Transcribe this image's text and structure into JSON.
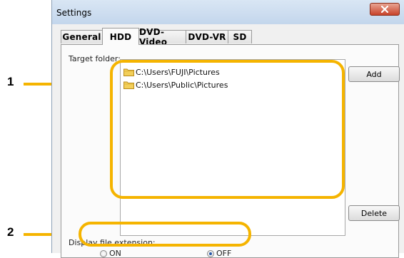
{
  "window": {
    "title": "Settings",
    "close_icon": "close-icon"
  },
  "tabs": [
    {
      "label": "General",
      "active": false
    },
    {
      "label": "HDD",
      "active": true
    },
    {
      "label": "DVD-Video",
      "active": false
    },
    {
      "label": "DVD-VR",
      "active": false
    },
    {
      "label": "SD",
      "active": false
    }
  ],
  "hdd": {
    "target_folder_label": "Target folder:",
    "folders": [
      {
        "path": "C:\\Users\\FUJI\\Pictures",
        "icon": "folder-icon"
      },
      {
        "path": "C:\\Users\\Public\\Pictures",
        "icon": "folder-icon"
      }
    ],
    "add_label": "Add",
    "delete_label": "Delete",
    "extension_label": "Display file extension:",
    "on_label": "ON",
    "off_label": "OFF",
    "selected": "OFF"
  },
  "callouts": {
    "one": "1",
    "two": "2"
  },
  "colors": {
    "highlight": "#f5b400",
    "titlebar": "#c3d6ec",
    "close": "#c8432a"
  }
}
